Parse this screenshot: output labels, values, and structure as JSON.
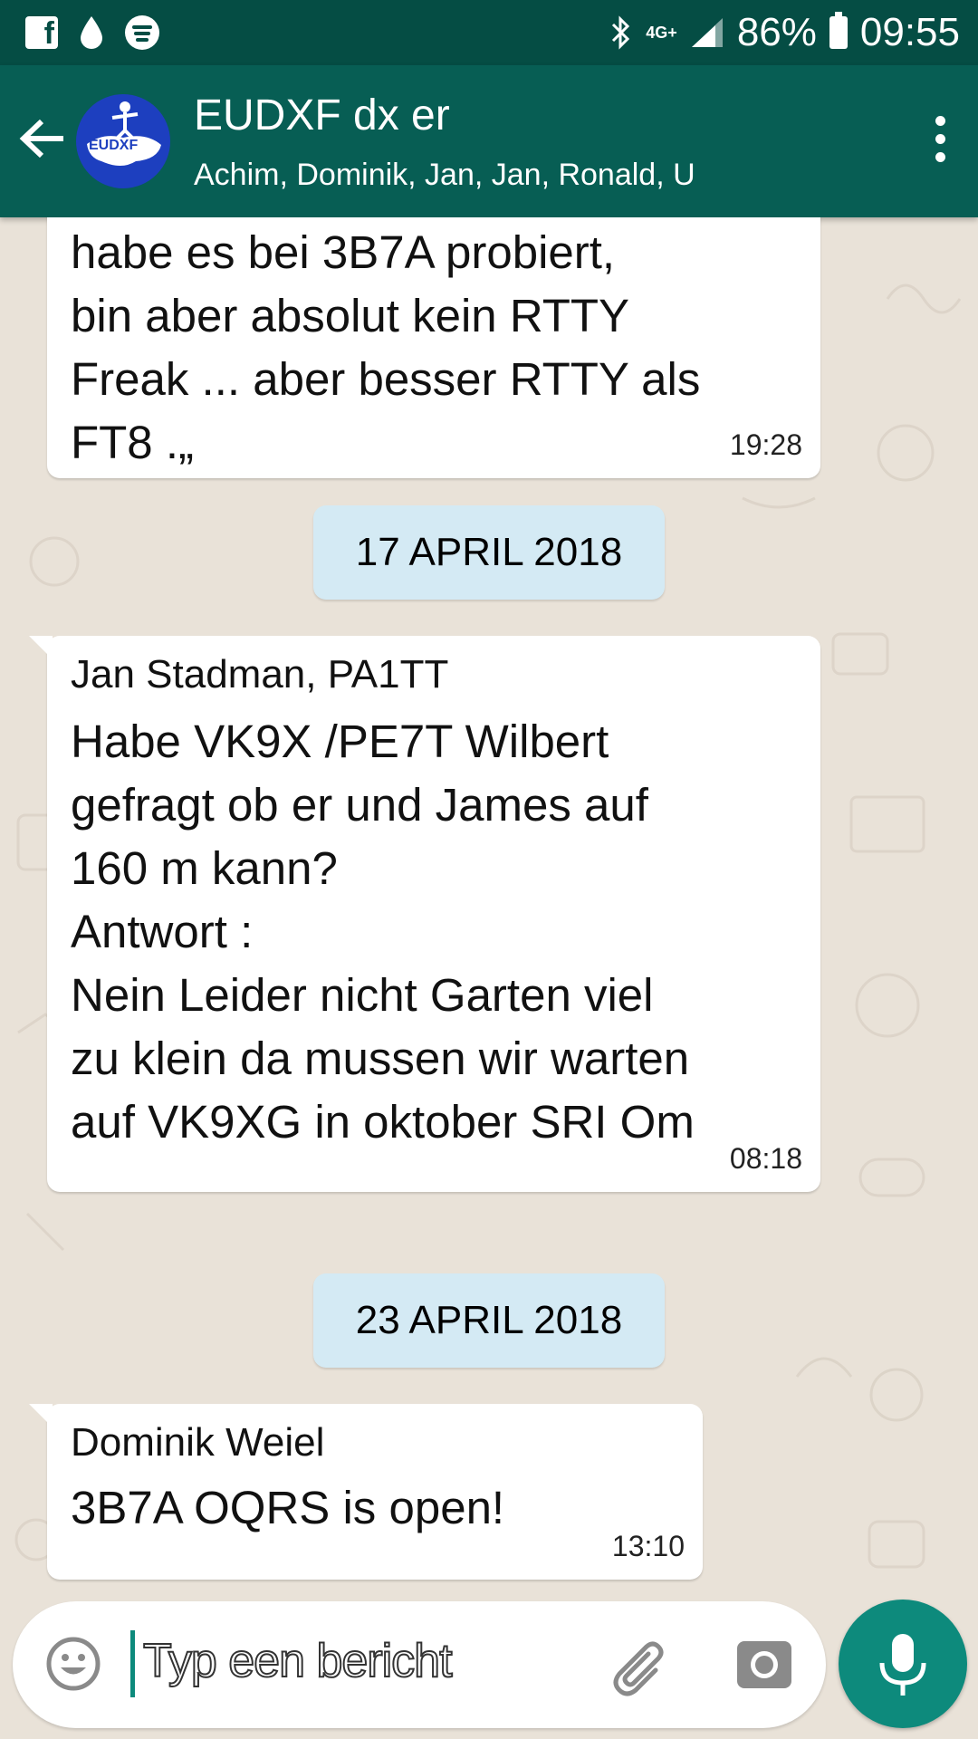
{
  "status_bar": {
    "network": "4G+",
    "battery": "86%",
    "time": "09:55"
  },
  "header": {
    "title": "EUDXF dx er",
    "participants": "Achim, Dominik, Jan, Jan, Ronald, U",
    "avatar_text": "EUDXF"
  },
  "messages": [
    {
      "text": "habe es bei 3B7A probiert,\nbin aber absolut kein RTTY\nFreak ... aber besser RTTY als\nFT8 .„",
      "time": "19:28"
    },
    {
      "sender": "Jan Stadman, PA1TT",
      "text": "Habe VK9X /PE7T Wilbert\ngefragt ob er und James  auf\n160 m kann?\nAntwort :\nNein Leider nicht Garten viel\nzu klein da mussen wir warten\nauf VK9XG in oktober SRI Om",
      "time": "08:18"
    },
    {
      "sender": "Dominik Weiel",
      "text": "3B7A OQRS is open!",
      "time": "13:10"
    }
  ],
  "dates": [
    "17 APRIL 2018",
    "23 APRIL 2018"
  ],
  "input": {
    "placeholder": "Typ een bericht"
  },
  "colors": {
    "status_bar": "#054d44",
    "app_bar": "#075e54",
    "accent": "#0d8a7c",
    "date_chip": "#d4eaf4",
    "chat_bg": "#e9e2d8"
  }
}
